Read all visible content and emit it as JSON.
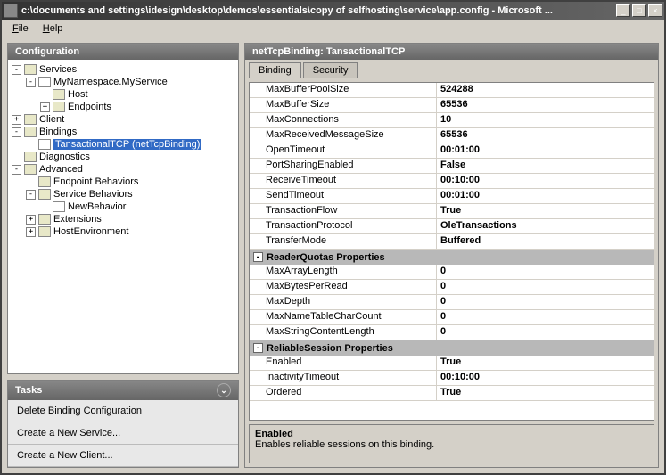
{
  "window": {
    "title": "c:\\documents and settings\\idesign\\desktop\\demos\\essentials\\copy of selfhosting\\service\\app.config - Microsoft ..."
  },
  "menu": {
    "file": "File",
    "help": "Help"
  },
  "leftPanel": {
    "title": "Configuration"
  },
  "tree": {
    "services": "Services",
    "myservice": "MyNamespace.MyService",
    "host": "Host",
    "endpoints": "Endpoints",
    "client": "Client",
    "bindings": "Bindings",
    "tansactional": "TansactionalTCP (netTcpBinding)",
    "diagnostics": "Diagnostics",
    "advanced": "Advanced",
    "endpointBehaviors": "Endpoint Behaviors",
    "serviceBehaviors": "Service Behaviors",
    "newBehavior": "NewBehavior",
    "extensions": "Extensions",
    "hostEnv": "HostEnvironment"
  },
  "tasks": {
    "title": "Tasks",
    "delete": "Delete Binding Configuration",
    "newService": "Create a New Service...",
    "newClient": "Create a New Client..."
  },
  "rightTitle": "netTcpBinding: TansactionalTCP",
  "tabs": {
    "binding": "Binding",
    "security": "Security"
  },
  "props": {
    "maxBufferPoolSize": {
      "l": "MaxBufferPoolSize",
      "v": "524288"
    },
    "maxBufferSize": {
      "l": "MaxBufferSize",
      "v": "65536"
    },
    "maxConnections": {
      "l": "MaxConnections",
      "v": "10"
    },
    "maxReceivedMessageSize": {
      "l": "MaxReceivedMessageSize",
      "v": "65536"
    },
    "openTimeout": {
      "l": "OpenTimeout",
      "v": "00:01:00"
    },
    "portSharingEnabled": {
      "l": "PortSharingEnabled",
      "v": "False"
    },
    "receiveTimeout": {
      "l": "ReceiveTimeout",
      "v": "00:10:00"
    },
    "sendTimeout": {
      "l": "SendTimeout",
      "v": "00:01:00"
    },
    "transactionFlow": {
      "l": "TransactionFlow",
      "v": "True"
    },
    "transactionProtocol": {
      "l": "TransactionProtocol",
      "v": "OleTransactions"
    },
    "transferMode": {
      "l": "TransferMode",
      "v": "Buffered"
    },
    "catReader": "ReaderQuotas Properties",
    "maxArrayLength": {
      "l": "MaxArrayLength",
      "v": "0"
    },
    "maxBytesPerRead": {
      "l": "MaxBytesPerRead",
      "v": "0"
    },
    "maxDepth": {
      "l": "MaxDepth",
      "v": "0"
    },
    "maxNameTableCharCount": {
      "l": "MaxNameTableCharCount",
      "v": "0"
    },
    "maxStringContentLength": {
      "l": "MaxStringContentLength",
      "v": "0"
    },
    "catReliable": "ReliableSession Properties",
    "enabled": {
      "l": "Enabled",
      "v": "True"
    },
    "inactivityTimeout": {
      "l": "InactivityTimeout",
      "v": "00:10:00"
    },
    "ordered": {
      "l": "Ordered",
      "v": "True"
    }
  },
  "help": {
    "title": "Enabled",
    "desc": "Enables reliable sessions on this binding."
  }
}
